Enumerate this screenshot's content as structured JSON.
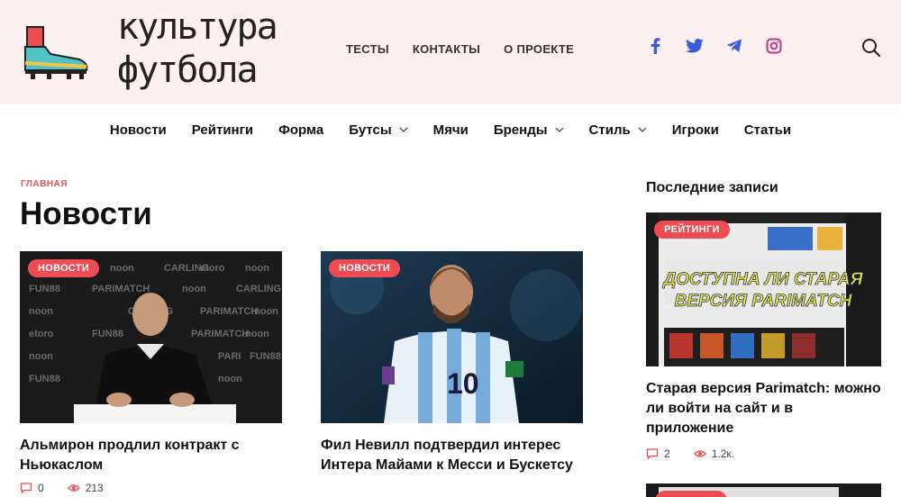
{
  "header": {
    "logo_line1": "культура",
    "logo_line2": "футбола",
    "top_menu": [
      "ТЕСТЫ",
      "КОНТАКТЫ",
      "О ПРОЕКТЕ"
    ],
    "socials": [
      "facebook-icon",
      "twitter-icon",
      "telegram-icon",
      "instagram-icon"
    ],
    "social_color": "#3b5bdb",
    "instagram_color": "#c13584",
    "background": "#fdf0f0"
  },
  "nav": {
    "items": [
      {
        "label": "Новости",
        "dropdown": false
      },
      {
        "label": "Рейтинги",
        "dropdown": false
      },
      {
        "label": "Форма",
        "dropdown": false
      },
      {
        "label": "Бутсы",
        "dropdown": true
      },
      {
        "label": "Мячи",
        "dropdown": false
      },
      {
        "label": "Бренды",
        "dropdown": true
      },
      {
        "label": "Стиль",
        "dropdown": true
      },
      {
        "label": "Игроки",
        "dropdown": false
      },
      {
        "label": "Статьи",
        "dropdown": false
      }
    ]
  },
  "breadcrumb": "ГЛАВНАЯ",
  "page_title": "Новости",
  "accent": "#ee4b53",
  "articles": [
    {
      "badge": "НОВОСТИ",
      "title": "Альмирон продлил контракт с Ньюкаслом",
      "comments": "0",
      "views": "213"
    },
    {
      "badge": "НОВОСТИ",
      "title": "Фил Невилл подтвердил интерес Интера Майами к Месси и Бускетсу",
      "comments": "",
      "views": ""
    }
  ],
  "sidebar": {
    "heading": "Последние записи",
    "post": {
      "badge": "РЕЙТИНГИ",
      "image_text_line1": "ДОСТУПНА ЛИ СТАРАЯ",
      "image_text_line2": "ВЕРСИЯ PARIMATCH",
      "title": "Старая версия Parimatch: можно ли войти на сайт и в приложение",
      "comments": "2",
      "views": "1.2к."
    }
  }
}
